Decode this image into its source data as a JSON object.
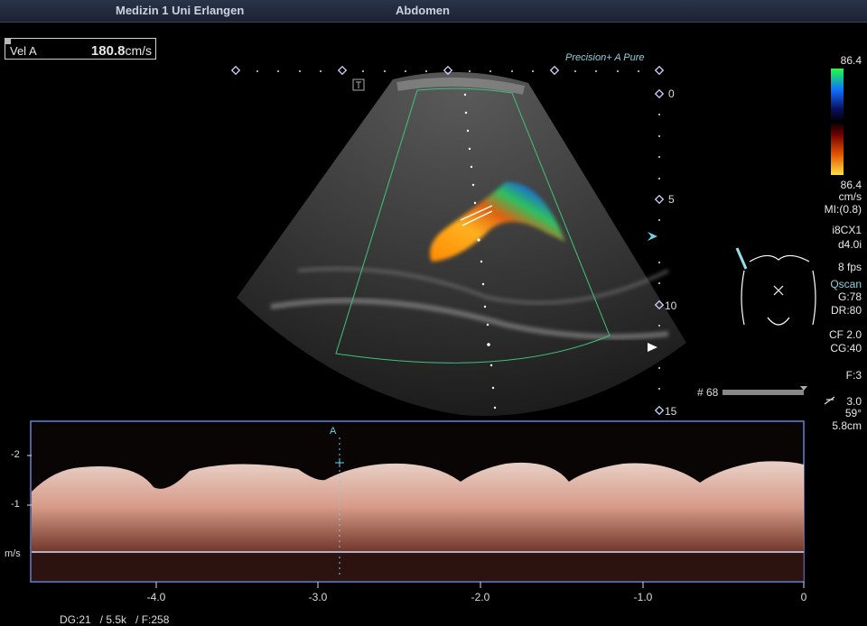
{
  "header": {
    "institution": "Medizin 1 Uni Erlangen",
    "exam": "Abdomen"
  },
  "velocity": {
    "label": "Vel A",
    "value": "180.8",
    "unit": "cm/s"
  },
  "brand": "Precision+ A Pure",
  "depth_scale": [
    "0",
    "5",
    "10",
    "15"
  ],
  "color_scale": {
    "top": "86.4",
    "bottom": "86.4",
    "unit": "cm/s"
  },
  "settings": [
    "MI:(0.8)",
    "i8CX1",
    "d4.0i",
    "8 fps",
    "Qscan",
    "G:78",
    "DR:80",
    "CF 2.0",
    "CG:40",
    "F:3",
    "3.0",
    "59°",
    "5.8cm"
  ],
  "frame_marker": "# 68",
  "cursor_label": "A",
  "spectral": {
    "y_ticks": [
      "-2",
      "-1"
    ],
    "y_unit": "m/s",
    "x_ticks": [
      "-4.0",
      "-3.0",
      "-2.0",
      "-1.0",
      "0"
    ]
  },
  "footer": "DG:21   / 5.5k   / F:258",
  "colors": {
    "frame": "#6a7fd6",
    "sector": "#3ec47a",
    "spectrum": "#f0b8a8",
    "cyan": "#6fd3e6"
  }
}
